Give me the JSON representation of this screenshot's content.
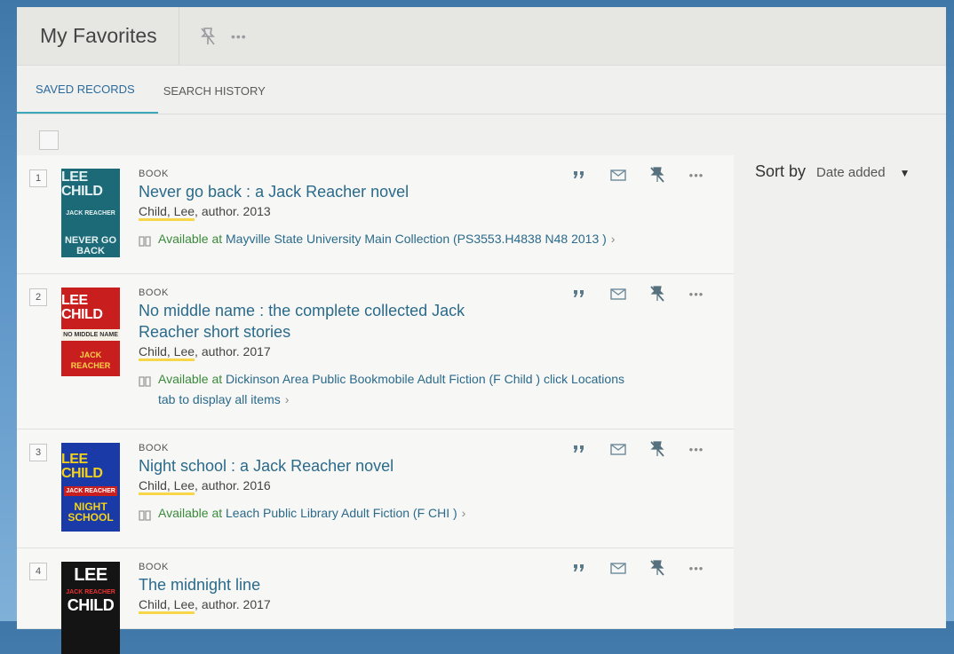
{
  "header": {
    "title": "My Favorites"
  },
  "tabs": [
    {
      "label": "SAVED RECORDS",
      "active": true
    },
    {
      "label": "SEARCH HISTORY",
      "active": false
    }
  ],
  "sort": {
    "label": "Sort by",
    "value": "Date added"
  },
  "records": [
    {
      "num": "1",
      "type": "BOOK",
      "title": "Never go back : a Jack Reacher novel",
      "author": "Child, Lee",
      "author_rest": ", author. 2013",
      "avail_prefix": "Available at ",
      "avail_location": "Mayville State University  Main Collection (PS3553.H4838 N48 2013 )",
      "cover": {
        "author": "LEE CHILD",
        "sub": "JACK REACHER",
        "title": "NEVER GO BACK",
        "bg": "#1c6a78",
        "fg": "#e6f2f2"
      }
    },
    {
      "num": "2",
      "type": "BOOK",
      "title": "No middle name : the complete collected Jack Reacher short stories",
      "author": "Child, Lee",
      "author_rest": ", author. 2017",
      "avail_prefix": "Available at ",
      "avail_location": "Dickinson Area Public Bookmobile  Adult Fiction (F Child ) click Locations tab to display all items",
      "cover": {
        "author": "LEE CHILD",
        "sub": "NO MIDDLE NAME",
        "title": "JACK REACHER",
        "bg": "#c81e1e",
        "fg": "#ffffff"
      }
    },
    {
      "num": "3",
      "type": "BOOK",
      "title": "Night school : a Jack Reacher novel",
      "author": "Child, Lee",
      "author_rest": ", author. 2016",
      "avail_prefix": "Available at ",
      "avail_location": "Leach Public Library  Adult Fiction (F CHI )",
      "cover": {
        "author": "LEE CHILD",
        "sub": "JACK REACHER",
        "title": "NIGHT SCHOOL",
        "bg": "#1a3aa8",
        "fg": "#f5d21a"
      }
    },
    {
      "num": "4",
      "type": "BOOK",
      "title": "The midnight line",
      "author": "Child, Lee",
      "author_rest": ", author. 2017",
      "avail_prefix": "",
      "avail_location": "",
      "cover": {
        "author": "LEE",
        "sub": "JACK REACHER",
        "title": "CHILD",
        "bg": "#141414",
        "fg": "#ffffff"
      }
    }
  ],
  "colors": {
    "accent_tab": "#3aa8b8",
    "title_link": "#2a6a8a",
    "available": "#3a8a3a",
    "author_highlight": "#f7d64a"
  },
  "icons": [
    "pin-off-icon",
    "more-icon",
    "quote-icon",
    "mail-icon",
    "book-icon",
    "chevron-right-icon",
    "caret-down-icon"
  ]
}
